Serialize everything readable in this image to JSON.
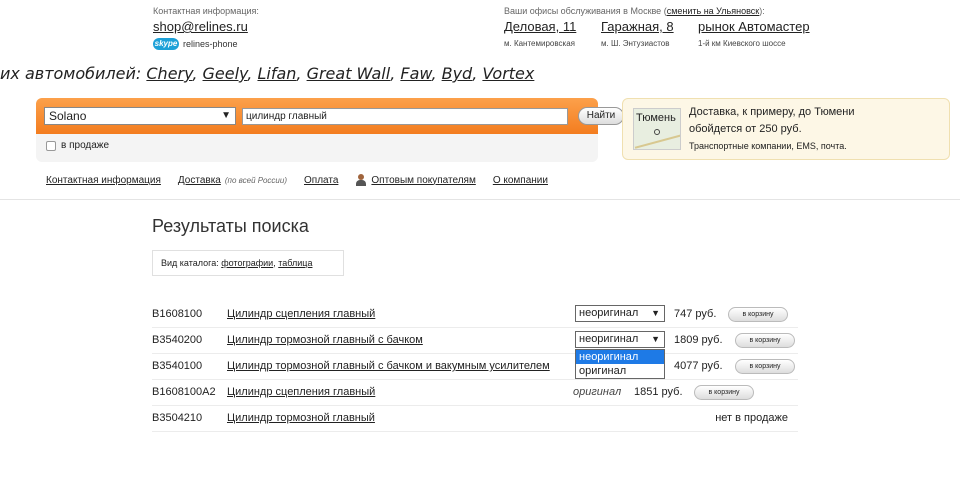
{
  "contact": {
    "label": "Контактная информация:",
    "email": "shop@relines.ru",
    "skype_badge": "skype",
    "skype_id": "relines-phone"
  },
  "offices": {
    "label_prefix": "Ваши офисы обслуживания в Москве (",
    "label_link": "сменить на Ульяновск",
    "label_suffix": "):",
    "items": [
      {
        "name": "Деловая, 11",
        "sub": "м. Кантемировская"
      },
      {
        "name": "Гаражная, 8",
        "sub": "м. Ш. Энтузиастов"
      },
      {
        "name": "рынок Автомастер",
        "sub": "1-й км Киевского шоссе"
      }
    ]
  },
  "brands": {
    "prefix": "их автомобилей:",
    "items": [
      "Chery",
      "Geely",
      "Lifan",
      "Great Wall",
      "Faw",
      "Byd",
      "Vortex"
    ]
  },
  "search": {
    "brand_value": "Solano",
    "query": "цилиндр главный",
    "button": "Найти",
    "in_stock_label": "в продаже"
  },
  "delivery": {
    "map_city": "Тюмень",
    "line1": "Доставка, к примеру, до Тюмени",
    "line2": "обойдется от 250 руб.",
    "line3": "Транспортные компании, EMS, почта."
  },
  "nav": {
    "contact": "Контактная информация",
    "delivery": "Доставка",
    "delivery_note": "(по всей России)",
    "payment": "Оплата",
    "wholesale": "Оптовым покупателям",
    "about": "О компании"
  },
  "results": {
    "title": "Результаты поиска",
    "view_label": "Вид каталога:",
    "view_photos": "фотографии",
    "view_table": "таблица",
    "cart_label": "в корзину",
    "rows": [
      {
        "code": "B1608100",
        "name": "Цилиндр сцепления главный",
        "select": "неоригинал",
        "price": "747 руб."
      },
      {
        "code": "B3540200",
        "name": "Цилиндр тормозной главный с бачком",
        "select": "неоригинал",
        "price": "1809 руб."
      },
      {
        "code": "B3540100",
        "name": "Цилиндр тормозной главный с бачком и вакумным усилителем",
        "price": "4077 руб."
      },
      {
        "code": "B1608100A2",
        "name": "Цилиндр сцепления главный",
        "origin": "оригинал",
        "price": "1851 руб."
      },
      {
        "code": "B3504210",
        "name": "Цилиндр тормозной главный",
        "status": "нет в продаже"
      }
    ],
    "dropdown_options": [
      "неоригинал",
      "оригинал"
    ]
  }
}
